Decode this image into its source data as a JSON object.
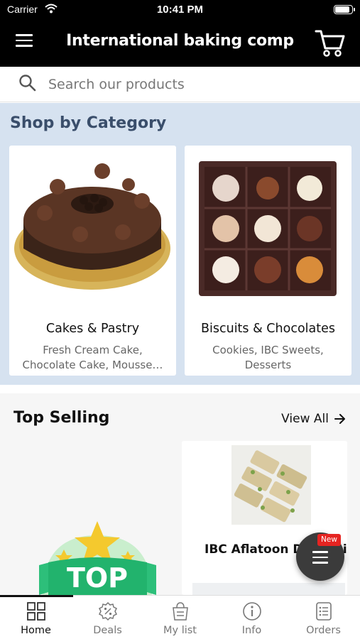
{
  "status_bar": {
    "carrier": "Carrier",
    "time": "10:41 PM",
    "battery_level": 0.95
  },
  "header": {
    "title": "International baking comp",
    "menu_icon": "hamburger-menu-icon",
    "cart_icon": "shopping-cart-icon"
  },
  "search": {
    "placeholder": "Search our products",
    "icon": "search-icon"
  },
  "categories": {
    "title": "Shop by Category",
    "items": [
      {
        "name": "Cakes & Pastry",
        "subtitle": "Fresh Cream Cake,\nChocolate Cake, Mousse…",
        "image": "chocolate-cake-image"
      },
      {
        "name": "Biscuits & Chocolates",
        "subtitle": "Cookies, IBC Sweets,\nDesserts",
        "image": "chocolate-box-image"
      }
    ]
  },
  "top_selling": {
    "title": "Top Selling",
    "view_all": "View All",
    "badge_text": "TOP",
    "products": [
      {
        "name": "IBC Aflatoon Dry Fruit"
      }
    ]
  },
  "fab": {
    "badge": "New",
    "icon": "menu-lines-icon"
  },
  "tabs": [
    {
      "label": "Home",
      "icon": "home-grid-icon",
      "active": true
    },
    {
      "label": "Deals",
      "icon": "deals-badge-icon",
      "active": false
    },
    {
      "label": "My list",
      "icon": "shopping-list-icon",
      "active": false
    },
    {
      "label": "Info",
      "icon": "info-icon",
      "active": false
    },
    {
      "label": "Orders",
      "icon": "orders-icon",
      "active": false
    }
  ],
  "colors": {
    "header_bg": "#000000",
    "category_bg": "#d6e2f0",
    "category_title": "#3a4e6b",
    "badge_red": "#e52421",
    "fab_bg": "#3b3b3b"
  }
}
